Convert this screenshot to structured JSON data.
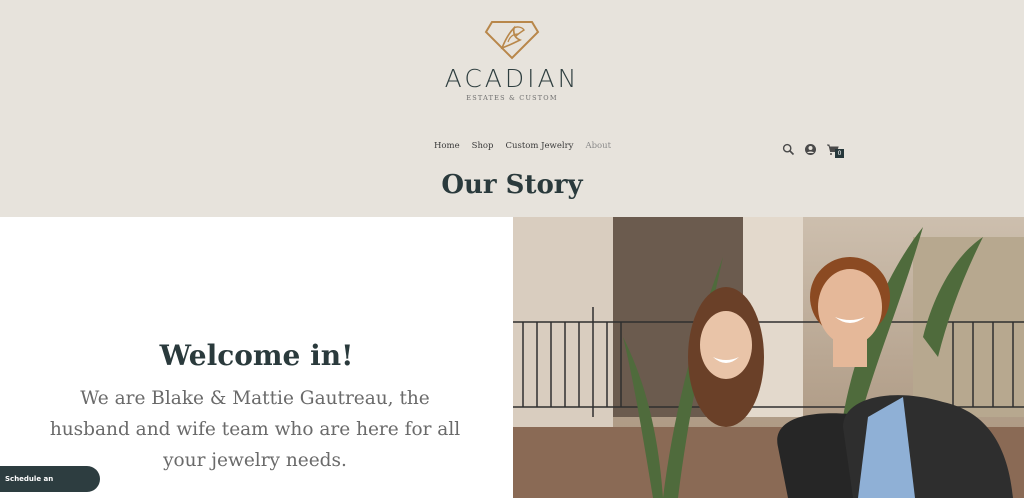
{
  "header": {
    "brand": "ACADIAN",
    "tagline": "ESTATES & CUSTOM",
    "nav": [
      "Home",
      "Shop",
      "Custom Jewelry",
      "About"
    ],
    "active_nav": "About",
    "cart_count": "0"
  },
  "page": {
    "title": "Our Story"
  },
  "intro": {
    "heading": "Welcome in!",
    "body": "We are Blake & Mattie Gautreau, the husband and wife team who are here for all your jewelry needs."
  },
  "cta": {
    "label": "Schedule an Appointment"
  },
  "colors": {
    "header_bg": "#e7e3dc",
    "brand_dark": "#2a3a3c",
    "logo_gold": "#b8874a"
  },
  "icons": [
    "diamond-logo-icon",
    "search-icon",
    "account-icon",
    "cart-icon"
  ]
}
